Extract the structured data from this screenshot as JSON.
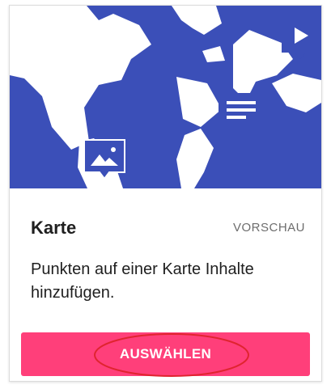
{
  "card": {
    "title": "Karte",
    "preview_label": "VORSCHAU",
    "description": "Punkten auf einer Karte Inhalte hinzufügen.",
    "select_label": "AUSWÄHLEN"
  },
  "hero": {
    "map_color": "#3b4fb8",
    "pin_icons": [
      "image-icon",
      "text-icon",
      "play-icon"
    ]
  },
  "colors": {
    "button": "#ff3f7a",
    "annotation": "#e0242f"
  }
}
